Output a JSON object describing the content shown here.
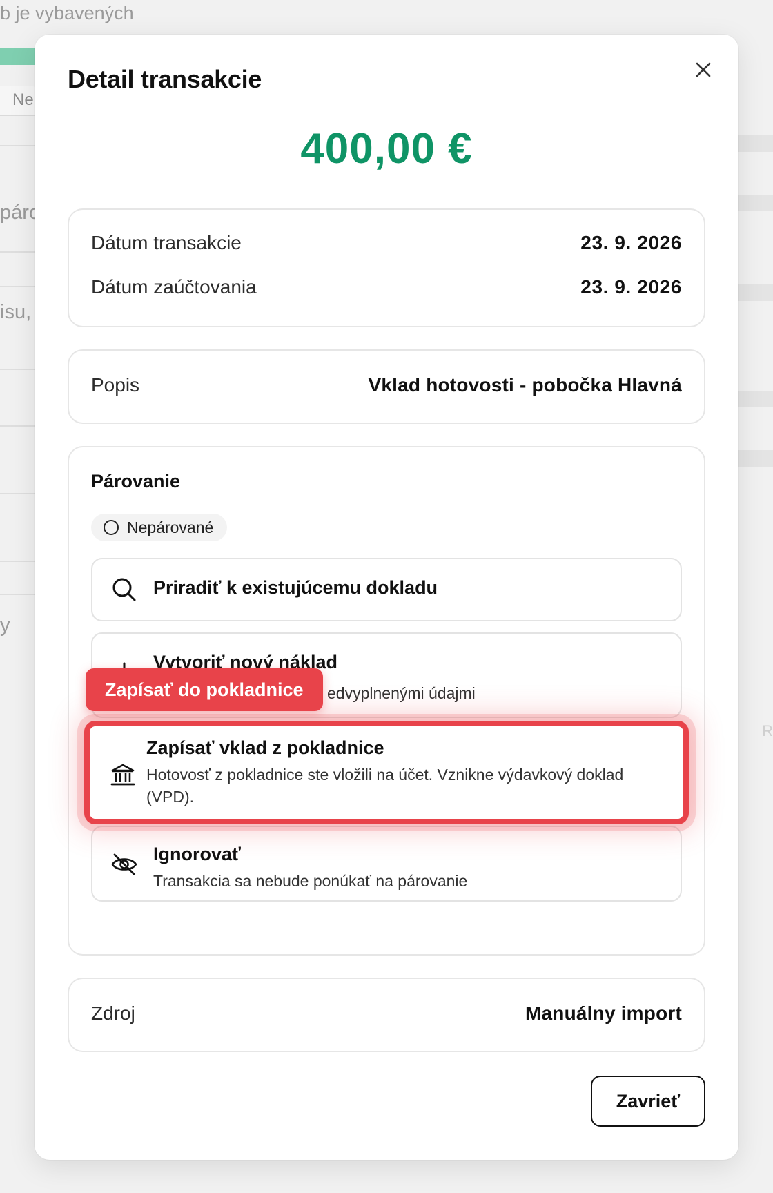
{
  "background": {
    "top_text": "b je vybavených",
    "pill_text": "Ne",
    "fragments": [
      "párc",
      "isu,",
      "y"
    ],
    "right_fragments": [
      "R"
    ]
  },
  "modal": {
    "title": "Detail transakcie",
    "amount": "400,00 €",
    "dates": {
      "transaction_label": "Dátum transakcie",
      "transaction_value": "23. 9. 2026",
      "posting_label": "Dátum zaúčtovania",
      "posting_value": "23. 9. 2026"
    },
    "description": {
      "label": "Popis",
      "value": "Vklad hotovosti - pobočka Hlavná"
    },
    "pairing": {
      "title": "Párovanie",
      "status": "Nepárované",
      "options": [
        {
          "title": "Priradiť k existujúcemu dokladu",
          "description": "",
          "icon": "search-icon"
        },
        {
          "title": "Vytvoriť nový náklad",
          "description": "edvyplnenými údajmi",
          "icon": "plus-icon"
        },
        {
          "title": "Zapísať vklad z pokladnice",
          "description": "Hotovosť z pokladnice ste vložili na účet. Vznikne výdavkový doklad (VPD).",
          "icon": "bank-icon"
        },
        {
          "title": "Ignorovať",
          "description": "Transakcia sa nebude ponúkať na párovanie",
          "icon": "eye-off-icon"
        }
      ]
    },
    "highlight_label": "Zapísať do pokladnice",
    "source": {
      "label": "Zdroj",
      "value": "Manuálny import"
    },
    "close_button": "Zavrieť"
  },
  "colors": {
    "amount": "#0f9466",
    "highlight": "#e8434a"
  }
}
